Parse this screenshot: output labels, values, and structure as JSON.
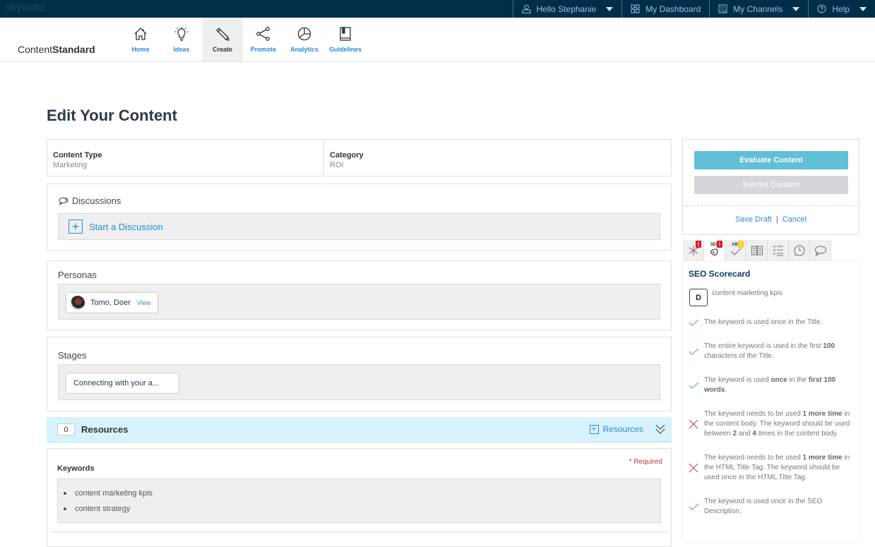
{
  "topbar": {
    "brand": "skyword",
    "menu": [
      {
        "icon": "user-icon",
        "label": "Hello Stephanie",
        "caret": true
      },
      {
        "icon": "dashboard-grid-icon",
        "label": "My Dashboard",
        "caret": false
      },
      {
        "icon": "channels-icon",
        "label": "My Channels",
        "caret": true
      },
      {
        "icon": "help-icon",
        "label": "Help",
        "caret": true
      }
    ]
  },
  "logo": {
    "light": "Content",
    "bold": "Standard"
  },
  "nav": [
    {
      "icon": "home-icon",
      "label": "Home",
      "active": false
    },
    {
      "icon": "lightbulb-icon",
      "label": "Ideas",
      "active": false
    },
    {
      "icon": "pencil-icon",
      "label": "Create",
      "active": true
    },
    {
      "icon": "share-icon",
      "label": "Promote",
      "active": false
    },
    {
      "icon": "pie-chart-icon",
      "label": "Analytics",
      "active": false
    },
    {
      "icon": "book-icon",
      "label": "Guidelines",
      "active": false
    }
  ],
  "page_title": "Edit Your Content",
  "meta": {
    "content_type_label": "Content Type",
    "content_type_value": "Marketing",
    "category_label": "Category",
    "category_value": "ROI"
  },
  "discussions": {
    "label": "Discussions",
    "start": "Start a Discussion"
  },
  "personas": {
    "label": "Personas",
    "items": [
      {
        "name": "Tomo, Doer",
        "view": "View"
      }
    ]
  },
  "stages": {
    "label": "Stages",
    "items": [
      {
        "name": "Connecting with your a..."
      }
    ]
  },
  "resources": {
    "count": "0",
    "label": "Resources",
    "add_label": "Resources"
  },
  "keywords": {
    "label": "Keywords",
    "required": "* Required",
    "items": [
      "content marketing kpis",
      "content strategy"
    ]
  },
  "actions": {
    "evaluate": "Evaluate Content",
    "submit": "Submit Content",
    "save_draft": "Save Draft",
    "separator": "|",
    "cancel": "Cancel"
  },
  "panel_tabs": [
    {
      "icon": "asterisk-icon",
      "badge": "!",
      "badge_color": "#e0161e",
      "active": false
    },
    {
      "icon": "seo-icon",
      "badge": "!",
      "badge_color": "#e0161e",
      "active": true
    },
    {
      "icon": "spellcheck-icon",
      "badge": "!",
      "badge_color": "#f4d01c",
      "active": false
    },
    {
      "icon": "open-book-icon",
      "badge": null,
      "active": false
    },
    {
      "icon": "checklist-icon",
      "badge": null,
      "active": false
    },
    {
      "icon": "history-icon",
      "badge": null,
      "active": false
    },
    {
      "icon": "comment-icon",
      "badge": null,
      "active": false
    }
  ],
  "scorecard": {
    "title": "SEO Scorecard",
    "grade": "D",
    "keyword": "content marketing kpis",
    "colors": {
      "pass": "#4cb87a",
      "fail": "#e0454a"
    },
    "checks": [
      {
        "status": "pass",
        "html": "The keyword is used once in the Title."
      },
      {
        "status": "pass",
        "html": "The entire keyword is used in the first <b>100</b> characters of the Title."
      },
      {
        "status": "pass",
        "html": "The keyword is used <b>once</b> in the <b>first 100 words</b>."
      },
      {
        "status": "fail",
        "html": "The keyword needs to be used <b>1 more time</b> in the content body. The keyword should be used between <b>2</b> and <b>4</b> times in the content body."
      },
      {
        "status": "fail",
        "html": "The keyword needs to be used <b>1 more time</b> in the HTML Title Tag. The keyword should be used once in the HTML Title Tag."
      },
      {
        "status": "pass",
        "html": "The keyword is used once in the SEO Description."
      }
    ]
  }
}
